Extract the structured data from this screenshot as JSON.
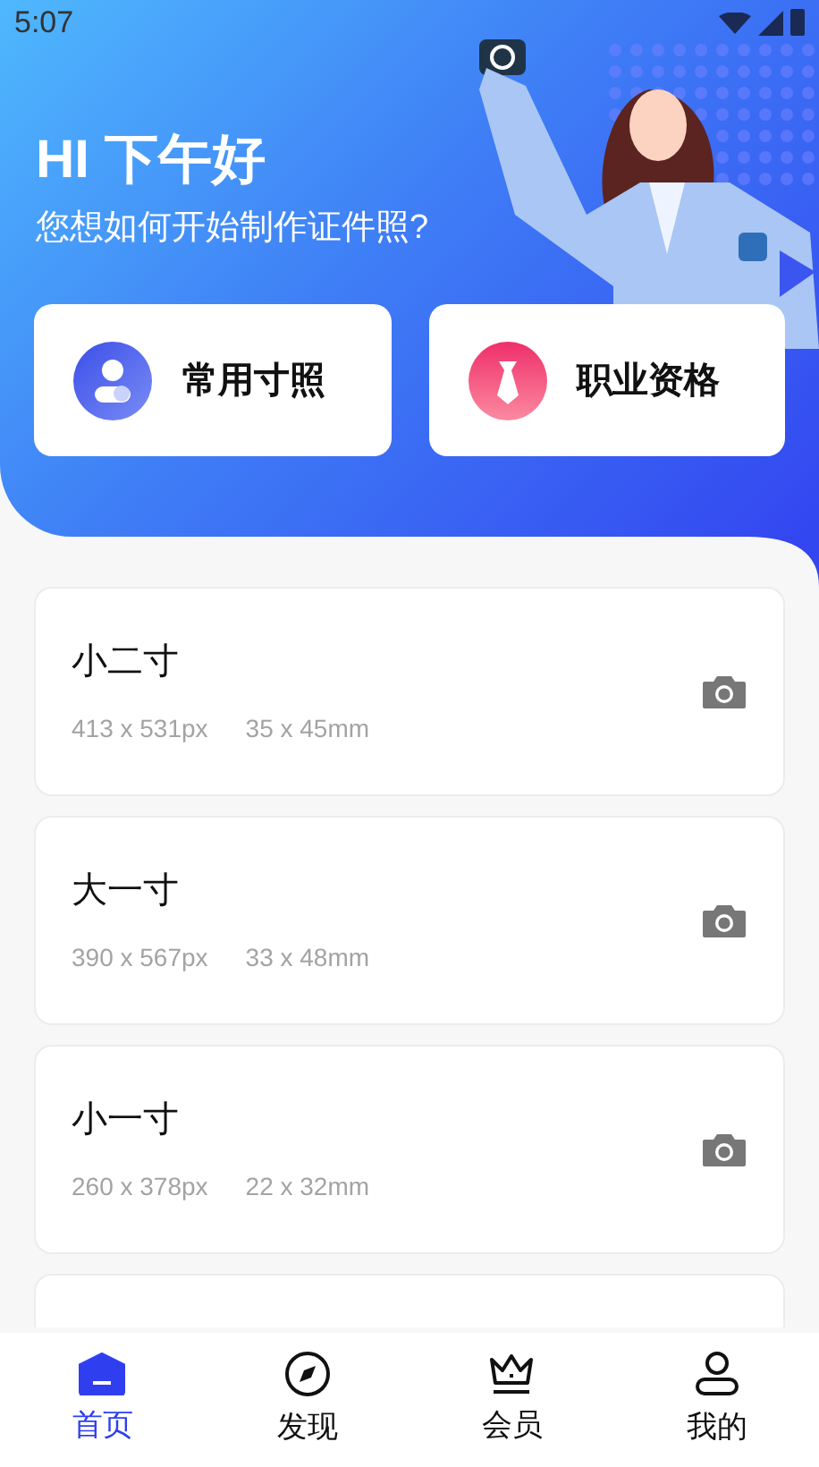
{
  "status_bar": {
    "time": "5:07"
  },
  "header": {
    "greeting": "HI 下午好",
    "subtitle": "您想如何开始制作证件照?"
  },
  "shortcuts": [
    {
      "label": "常用寸照",
      "kind": "person"
    },
    {
      "label": "职业资格",
      "kind": "tie"
    }
  ],
  "sizes": [
    {
      "name": "小二寸",
      "pixels": "413 x 531px",
      "mm": "35 x 45mm"
    },
    {
      "name": "大一寸",
      "pixels": "390 x 567px",
      "mm": "33 x 48mm"
    },
    {
      "name": "小一寸",
      "pixels": "260 x 378px",
      "mm": "22 x 32mm"
    }
  ],
  "nav": [
    {
      "label": "首页",
      "kind": "home",
      "selected": true
    },
    {
      "label": "发现",
      "kind": "compass",
      "selected": false
    },
    {
      "label": "会员",
      "kind": "crown",
      "selected": false
    },
    {
      "label": "我的",
      "kind": "user",
      "selected": false
    }
  ]
}
